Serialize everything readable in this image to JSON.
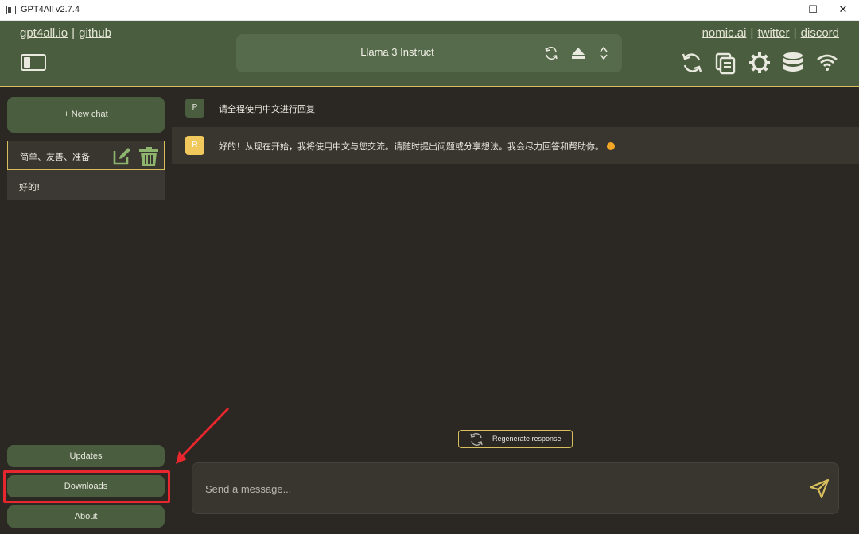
{
  "window": {
    "title": "GPT4All v2.7.4",
    "minimize": "—",
    "maximize": "☐",
    "close": "✕"
  },
  "header": {
    "links_left": [
      "gpt4all.io",
      "github"
    ],
    "links_right": [
      "nomic.ai",
      "twitter",
      "discord"
    ],
    "separator": "|",
    "model_name": "Llama 3 Instruct",
    "accent_color": "#d7bf5e",
    "header_color": "#4a5e3f"
  },
  "sidebar": {
    "new_chat": "+  New chat",
    "chats": [
      {
        "label": "简单、友善、准备",
        "active": true
      },
      {
        "label": "好的!",
        "active": false
      }
    ],
    "updates": "Updates",
    "downloads": "Downloads",
    "about": "About"
  },
  "conversation": {
    "messages": [
      {
        "avatar": "P",
        "text": "请全程使用中文进行回复"
      },
      {
        "avatar": "R",
        "text": "好的！从现在开始，我将使用中文与您交流。请随时提出问题或分享想法。我会尽力回答和帮助你。"
      }
    ],
    "regenerate": "Regenerate response",
    "input_placeholder": "Send a message..."
  },
  "icons": {
    "header": [
      "sidebar-toggle-icon",
      "reload-icon",
      "eject-icon",
      "updown-chevron-icon",
      "recycle-icon",
      "copy-icon",
      "gear-icon",
      "database-icon",
      "wifi-icon"
    ],
    "chat_actions": [
      "edit-icon",
      "trash-icon"
    ],
    "send": "send-icon"
  },
  "annotation": {
    "highlight_color": "#e8262d"
  }
}
